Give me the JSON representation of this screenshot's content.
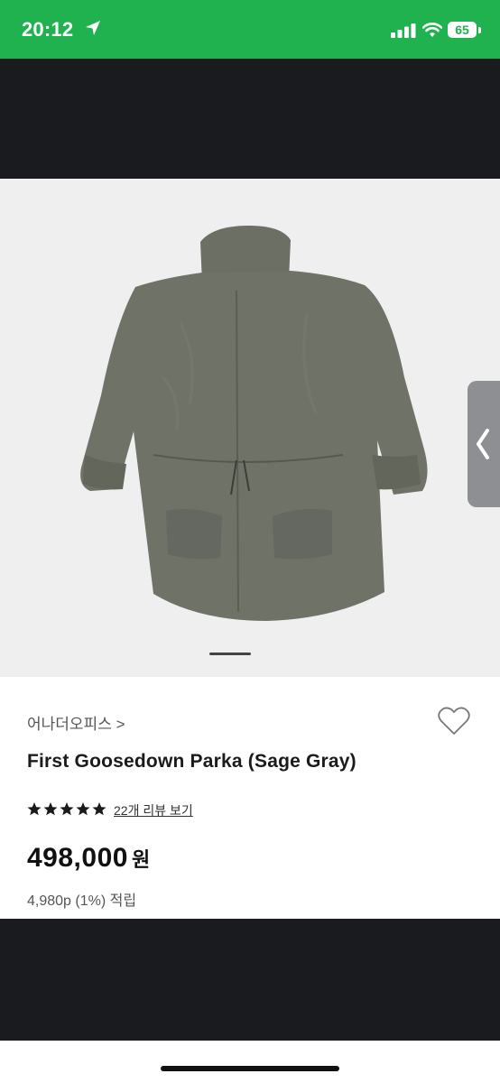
{
  "status_bar": {
    "time": "20:12",
    "battery": "65",
    "background_color": "#1fb24f"
  },
  "product": {
    "image_description_color": "#6e7267",
    "brand": "어나더오피스 >",
    "title": "First Goosedown Parka (Sage Gray)",
    "rating": {
      "stars": 5,
      "review_link": "22개 리뷰 보기"
    },
    "price": "498,000",
    "currency": "원",
    "points": "4,980p (1%) 적립"
  },
  "icons": {
    "location": "location-arrow-icon",
    "signal": "cellular-signal-icon",
    "wifi": "wifi-icon",
    "heart": "heart-outline-icon",
    "back": "chevron-left-icon",
    "star": "star-icon"
  }
}
